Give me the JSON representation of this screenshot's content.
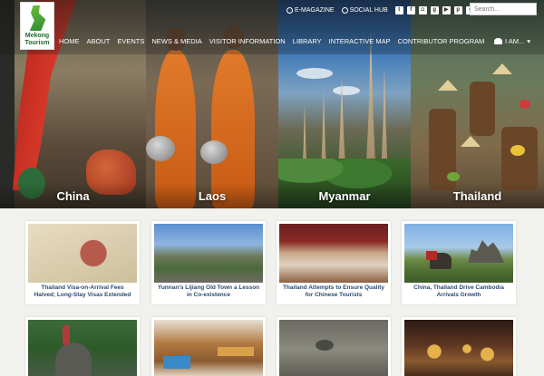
{
  "logo": {
    "line1": "Mekong",
    "line2": "Tourism"
  },
  "topbar": {
    "emagazine": "E-MAGAZINE",
    "social_hub": "SOCIAL HUB",
    "social_icons": [
      "twitter",
      "facebook",
      "instagram",
      "google-plus",
      "youtube",
      "pinterest",
      "flickr",
      "linkedin",
      "tumblr",
      "vimeo",
      "email"
    ],
    "search_placeholder": "Search..."
  },
  "nav": {
    "items": [
      "HOME",
      "ABOUT",
      "EVENTS",
      "NEWS & MEDIA",
      "VISITOR INFORMATION",
      "LIBRARY",
      "INTERACTIVE MAP",
      "CONTRIBUTOR PROGRAM"
    ],
    "iam": "I AM..."
  },
  "hero": {
    "panels": [
      "China",
      "Laos",
      "Myanmar",
      "Thailand"
    ]
  },
  "articles": [
    {
      "title": "Thailand Visa-on-Arrival Fees Halved; Long-Stay Visas Extended"
    },
    {
      "title": "Yunnan's Lijiang Old Town a Lesson in Co-existence"
    },
    {
      "title": "Thailand Attempts to Ensure Quality for Chinese Tourists"
    },
    {
      "title": "China, Thailand Drive Cambodia Arrivals Growth"
    },
    {
      "title": ""
    },
    {
      "title": ""
    },
    {
      "title": ""
    },
    {
      "title": ""
    }
  ]
}
